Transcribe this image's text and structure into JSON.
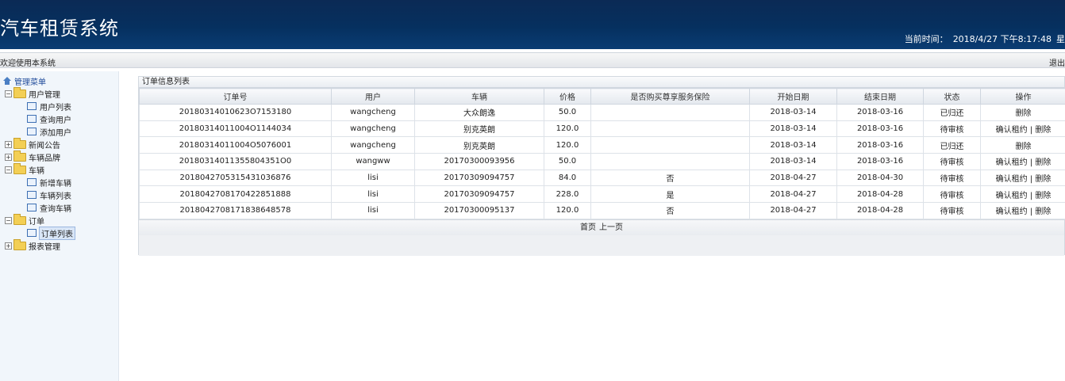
{
  "header": {
    "title": "汽车租赁系统",
    "time_label": "当前时间：",
    "time_value": "2018/4/27 下午8:17:48",
    "time_suffix": "星"
  },
  "welcome": {
    "message": "欢迎使用本系统",
    "logout": "退出"
  },
  "sidebar": {
    "root": "管理菜单",
    "groups": [
      {
        "label": "用户管理",
        "expanded": true,
        "items": [
          "用户列表",
          "查询用户",
          "添加用户"
        ]
      },
      {
        "label": "新闻公告",
        "expanded": false,
        "items": []
      },
      {
        "label": "车辆品牌",
        "expanded": false,
        "items": []
      },
      {
        "label": "车辆",
        "expanded": true,
        "items": [
          "新增车辆",
          "车辆列表",
          "查询车辆"
        ]
      },
      {
        "label": "订单",
        "expanded": true,
        "items": [
          "订单列表"
        ]
      },
      {
        "label": "报表管理",
        "expanded": false,
        "items": []
      }
    ],
    "selected": "订单列表"
  },
  "panel": {
    "title": "订单信息列表",
    "columns": [
      "订单号",
      "用户",
      "车辆",
      "价格",
      "是否购买尊享服务保险",
      "开始日期",
      "结束日期",
      "状态",
      "操作"
    ],
    "rows": [
      [
        "20180314010623O7153180",
        "wangcheng",
        "大众朗逸",
        "50.0",
        "",
        "2018-03-14",
        "2018-03-16",
        "已归还",
        "删除"
      ],
      [
        "20180314011004O1144034",
        "wangcheng",
        "别克英朗",
        "120.0",
        "",
        "2018-03-14",
        "2018-03-16",
        "待审核",
        "确认租约 | 删除"
      ],
      [
        "20180314011004O5076001",
        "wangcheng",
        "别克英朗",
        "120.0",
        "",
        "2018-03-14",
        "2018-03-16",
        "已归还",
        "删除"
      ],
      [
        "20180314011355804351O0",
        "wangww",
        "20170300093956",
        "50.0",
        "",
        "2018-03-14",
        "2018-03-16",
        "待审核",
        "确认租约 | 删除"
      ],
      [
        "20180427053154310368​76",
        "lisi",
        "20170309094757",
        "84.0",
        "否",
        "2018-04-27",
        "2018-04-30",
        "待审核",
        "确认租约 | 删除"
      ],
      [
        "20180427081704228518​88",
        "lisi",
        "20170309094757",
        "228.0",
        "是",
        "2018-04-27",
        "2018-04-28",
        "待审核",
        "确认租约 | 删除"
      ],
      [
        "20180427081718386485​78",
        "lisi",
        "20170300095137",
        "120.0",
        "否",
        "2018-04-27",
        "2018-04-28",
        "待审核",
        "确认租约 | 删除"
      ]
    ],
    "pager": {
      "first": "首页",
      "prev": "上一页"
    }
  }
}
